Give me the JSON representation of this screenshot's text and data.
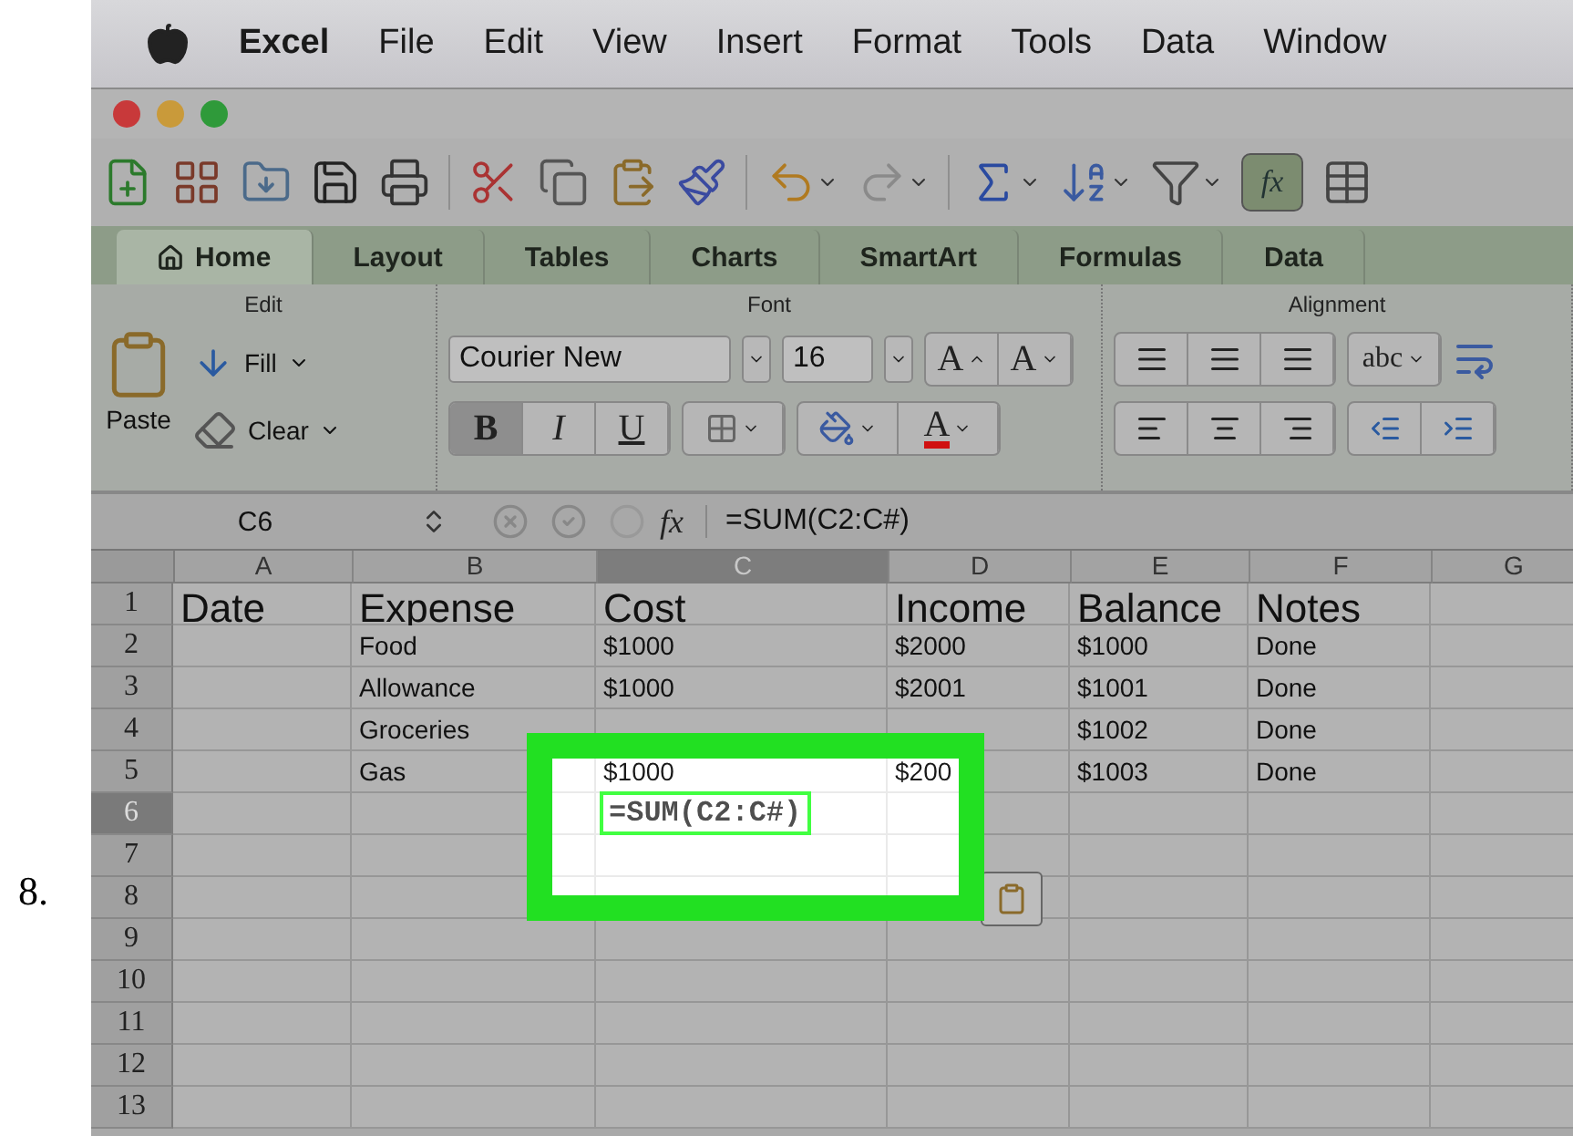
{
  "step": "8.",
  "menu_bar": {
    "app": "Excel",
    "items": [
      "File",
      "Edit",
      "View",
      "Insert",
      "Format",
      "Tools",
      "Data",
      "Window"
    ]
  },
  "toolbar": {
    "formula_button": "fx",
    "formula_button_on": true
  },
  "ribbon_tabs": [
    {
      "label": "Home",
      "selected": true
    },
    {
      "label": "Layout",
      "selected": false
    },
    {
      "label": "Tables",
      "selected": false
    },
    {
      "label": "Charts",
      "selected": false
    },
    {
      "label": "SmartArt",
      "selected": false
    },
    {
      "label": "Formulas",
      "selected": false
    },
    {
      "label": "Data",
      "selected": false
    }
  ],
  "ribbon": {
    "edit": {
      "title": "Edit",
      "paste": "Paste",
      "fill": "Fill",
      "clear": "Clear"
    },
    "font": {
      "title": "Font",
      "family": "Courier New",
      "size": "16",
      "grow": "A",
      "shrink": "A",
      "bold": "B",
      "italic": "I",
      "underline": "U",
      "bold_on": true,
      "font_color": "A"
    },
    "alignment": {
      "title": "Alignment",
      "wrap": "abc"
    }
  },
  "formula_bar": {
    "cell": "C6",
    "fx": "fx",
    "formula": "=SUM(C2:C#)"
  },
  "sheet": {
    "highlight": true,
    "columns": [
      {
        "label": "A",
        "selected": false
      },
      {
        "label": "B",
        "selected": false
      },
      {
        "label": "C",
        "selected": true
      },
      {
        "label": "D",
        "selected": false
      },
      {
        "label": "E",
        "selected": false
      },
      {
        "label": "F",
        "selected": false
      },
      {
        "label": "G",
        "selected": false
      }
    ],
    "rows": [
      {
        "label": "1",
        "selected": false,
        "kind": "heading",
        "cells": [
          "Date",
          "Expense",
          "Cost",
          "Income",
          "Balance",
          "Notes",
          null
        ]
      },
      {
        "label": "2",
        "selected": false,
        "kind": "data",
        "cells": [
          null,
          "Food",
          "$1000",
          "$2000",
          "$1000",
          "Done",
          null
        ]
      },
      {
        "label": "3",
        "selected": false,
        "kind": "data",
        "cells": [
          null,
          "Allowance",
          "$1000",
          "$2001",
          "$1001",
          "Done",
          null
        ]
      },
      {
        "label": "4",
        "selected": false,
        "kind": "data",
        "cells": [
          null,
          "Groceries",
          null,
          null,
          "$1002",
          "Done",
          null
        ]
      },
      {
        "label": "5",
        "selected": false,
        "kind": "data",
        "cells": [
          null,
          "Gas",
          "$1000",
          "$200",
          "$1003",
          "Done",
          null
        ]
      },
      {
        "label": "6",
        "selected": true,
        "kind": "data",
        "cells": [
          null,
          null,
          "=SUM(C2:C#)",
          null,
          null,
          null,
          null
        ]
      },
      {
        "label": "7",
        "selected": false,
        "kind": "data",
        "cells": [
          null,
          null,
          null,
          null,
          null,
          null,
          null
        ]
      },
      {
        "label": "8",
        "selected": false,
        "kind": "data",
        "cells": [
          null,
          null,
          null,
          null,
          null,
          null,
          null
        ]
      },
      {
        "label": "9",
        "selected": false,
        "kind": "data",
        "cells": [
          null,
          null,
          null,
          null,
          null,
          null,
          null
        ]
      },
      {
        "label": "10",
        "selected": false,
        "kind": "data",
        "cells": [
          null,
          null,
          null,
          null,
          null,
          null,
          null
        ]
      },
      {
        "label": "11",
        "selected": false,
        "kind": "data",
        "cells": [
          null,
          null,
          null,
          null,
          null,
          null,
          null
        ]
      },
      {
        "label": "12",
        "selected": false,
        "kind": "data",
        "cells": [
          null,
          null,
          null,
          null,
          null,
          null,
          null
        ]
      },
      {
        "label": "13",
        "selected": false,
        "kind": "data",
        "cells": [
          null,
          null,
          null,
          null,
          null,
          null,
          null
        ]
      }
    ]
  }
}
